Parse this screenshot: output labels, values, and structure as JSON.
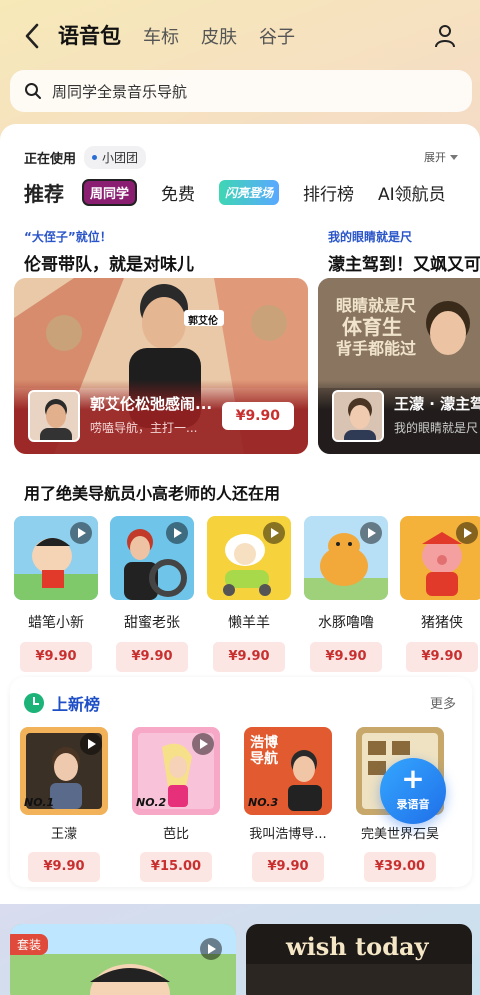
{
  "header": {
    "tabs": [
      {
        "label": "语音包",
        "active": true
      },
      {
        "label": "车标"
      },
      {
        "label": "皮肤"
      },
      {
        "label": "谷子"
      }
    ]
  },
  "search": {
    "placeholder": "周同学全景音乐导航"
  },
  "in_use": {
    "label": "正在使用",
    "current": "小团团",
    "expand_label": "展开"
  },
  "categories": [
    {
      "label": "推荐",
      "active": true
    },
    {
      "label": "周同学",
      "style": "pill"
    },
    {
      "label": "免费"
    },
    {
      "label": "闪亮登场",
      "style": "pill-gradient"
    },
    {
      "label": "排行榜"
    },
    {
      "label": "AI领航员"
    }
  ],
  "promos": [
    {
      "kicker": "“大侄子”就位！",
      "title": "伦哥带队，就是对味儿",
      "banner_title": "郭艾伦松弛感闹...",
      "banner_sub": "唠嗑导航，主打一...",
      "art_tag": "郭艾伦",
      "price": "¥9.90"
    },
    {
      "kicker": "我的眼睛就是尺",
      "title": "濛主驾到！又飒又可",
      "banner_title": "王濛 · 濛主驾",
      "banner_sub": "我的眼睛就是尺",
      "art_text": [
        "眼睛就是尺",
        "体育生",
        "背手都能过"
      ],
      "price": ""
    }
  ],
  "also_used": {
    "title": "用了绝美导航员小高老师的人还在用",
    "items": [
      {
        "name": "蜡笔小新",
        "price": "¥9.90",
        "color": "#8fd0ee"
      },
      {
        "name": "甜蜜老张",
        "price": "¥9.90",
        "color": "#6fc4ea"
      },
      {
        "name": "懒羊羊",
        "price": "¥9.90",
        "color": "#f6d23c"
      },
      {
        "name": "水豚噜噜",
        "price": "¥9.90",
        "color": "#b7dff6"
      },
      {
        "name": "猪猪侠",
        "price": "¥9.90",
        "color": "#f4b23a"
      }
    ]
  },
  "new_list": {
    "title": "上新榜",
    "more_label": "更多",
    "items": [
      {
        "rank": "NO.1",
        "name": "王濛",
        "price": "¥9.90",
        "color": "#f2b25a"
      },
      {
        "rank": "NO.2",
        "name": "芭比",
        "price": "¥15.00",
        "color": "#f6a8c6"
      },
      {
        "rank": "NO.3",
        "name": "我叫浩博导...",
        "price": "¥9.90",
        "color": "#e25a2f",
        "art_text": [
          "浩博",
          "导航"
        ]
      },
      {
        "rank": "",
        "name": "完美世界石昊",
        "price": "¥39.00",
        "color": "#c8a86a"
      }
    ]
  },
  "fab": {
    "label": "录语音"
  },
  "bottom": {
    "tag": "套装",
    "wish_text": "wish today"
  }
}
